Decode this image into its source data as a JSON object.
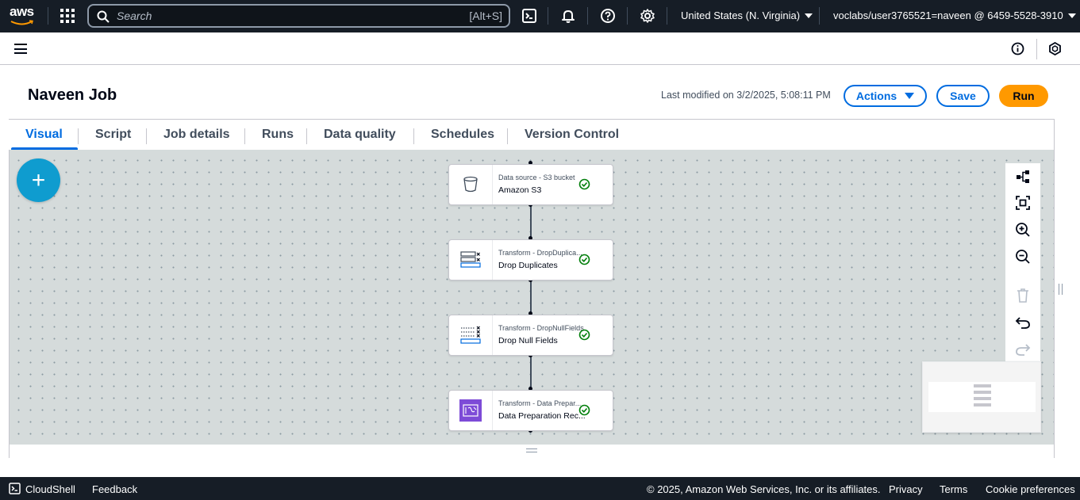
{
  "topnav": {
    "logo_text": "aws",
    "search_placeholder": "Search",
    "search_shortcut": "[Alt+S]",
    "region": "United States (N. Virginia)",
    "account": "voclabs/user3765521=naveen @ 6459-5528-3910",
    "icons": [
      "services-grid-icon",
      "search-icon",
      "cloudshell-icon",
      "bell-icon",
      "help-icon",
      "settings-icon"
    ]
  },
  "page": {
    "title": "Naveen Job",
    "last_modified": "Last modified on 3/2/2025, 5:08:11 PM",
    "actions_label": "Actions",
    "save_label": "Save",
    "run_label": "Run"
  },
  "tabs": [
    {
      "label": "Visual",
      "active": true
    },
    {
      "label": "Script"
    },
    {
      "label": "Job details"
    },
    {
      "label": "Runs"
    },
    {
      "label": "Data quality"
    },
    {
      "label": "Schedules"
    },
    {
      "label": "Version Control"
    }
  ],
  "canvas": {
    "add_button": "+",
    "nodes": [
      {
        "kind": "Data source - S3 bucket",
        "name": "Amazon S3",
        "icon": "bucket-icon",
        "status": "success"
      },
      {
        "kind": "Transform - DropDuplica...",
        "name": "Drop Duplicates",
        "icon": "drop-duplicates-icon",
        "status": "success"
      },
      {
        "kind": "Transform - DropNullFields",
        "name": "Drop Null Fields",
        "icon": "drop-null-fields-icon",
        "status": "success"
      },
      {
        "kind": "Transform - Data Prepar...",
        "name": "Data Preparation Rec...",
        "icon": "data-prep-icon",
        "status": "success"
      }
    ],
    "toolbar": [
      "layout-icon",
      "fit-view-icon",
      "zoom-in-icon",
      "zoom-out-icon",
      "delete-icon",
      "undo-icon",
      "redo-icon"
    ]
  },
  "footer": {
    "cloudshell": "CloudShell",
    "feedback": "Feedback",
    "copyright": "© 2025, Amazon Web Services, Inc. or its affiliates.",
    "privacy": "Privacy",
    "terms": "Terms",
    "cookies": "Cookie preferences"
  },
  "colors": {
    "nav_bg": "#161d26",
    "accent_blue": "#006ce0",
    "run_orange": "#ff9900",
    "add_button": "#0f9ccf",
    "success_green": "#037f0c",
    "canvas_bg": "#d5dbdb",
    "data_prep_purple": "#7d4bd7"
  }
}
